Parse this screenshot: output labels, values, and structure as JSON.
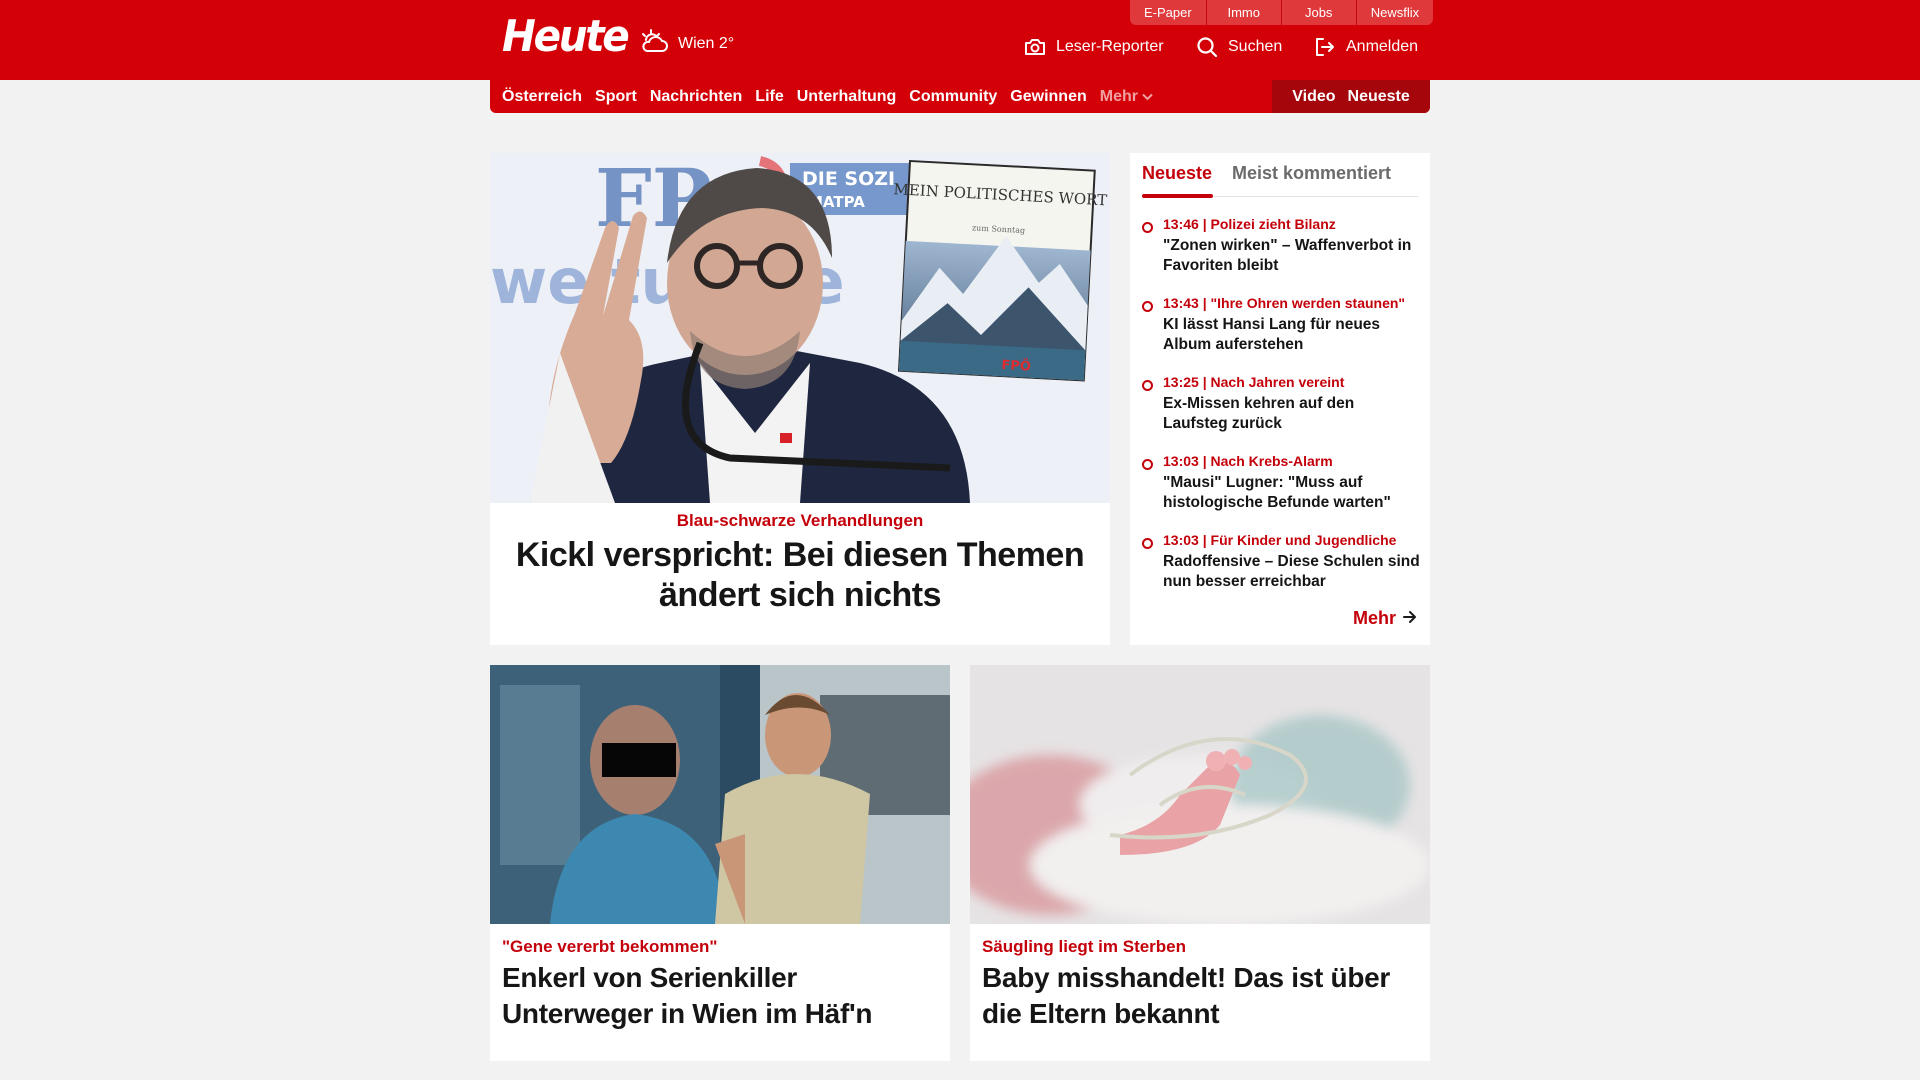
{
  "header": {
    "logo": "Heute",
    "weather": {
      "icon": "cloud-sun-icon",
      "text": "Wien 2°"
    },
    "service_tabs": [
      "E-Paper",
      "Immo",
      "Jobs",
      "Newsflix"
    ],
    "tools": [
      {
        "icon": "camera-icon",
        "label": "Leser-Reporter"
      },
      {
        "icon": "search-icon",
        "label": "Suchen"
      },
      {
        "icon": "login-icon",
        "label": "Anmelden"
      }
    ]
  },
  "nav": {
    "items": [
      "Österreich",
      "Sport",
      "Nachrichten",
      "Life",
      "Unterhaltung",
      "Community",
      "Gewinnen"
    ],
    "more": "Mehr",
    "right": [
      "Video",
      "Neueste"
    ]
  },
  "hero": {
    "kicker": "Blau-schwarze Verhandlungen",
    "title": "Kickl verspricht: Bei diesen Themen ändert sich nichts",
    "image_text": {
      "backdrop_letters": "FP",
      "backdrop_line1": "DIE SOZI",
      "backdrop_line2": "MATPA",
      "backdrop_big": "we  tu     ür  e",
      "book_title": "MEIN POLITISCHES WORT",
      "book_subtitle": "zum Sonntag",
      "book_logo": "FPÖ"
    }
  },
  "sidebar": {
    "tabs": [
      "Neueste",
      "Meist kommentiert"
    ],
    "items": [
      {
        "time": "13:46",
        "kicker": "Polizei zieht Bilanz",
        "headline": "\"Zonen wirken\" – Waffenverbot in Favoriten bleibt"
      },
      {
        "time": "13:43",
        "kicker": "\"Ihre Ohren werden staunen\"",
        "headline": "KI lässt Hansi Lang für neues Album auferstehen"
      },
      {
        "time": "13:25",
        "kicker": "Nach Jahren vereint",
        "headline": "Ex-Missen kehren auf den Laufsteg zurück"
      },
      {
        "time": "13:03",
        "kicker": "Nach Krebs-Alarm",
        "headline": "\"Mausi\" Lugner: \"Muss auf histologische Befunde warten\""
      },
      {
        "time": "13:03",
        "kicker": "Für Kinder und Jugendliche",
        "headline": "Radoffensive – Diese Schulen sind nun besser erreichbar"
      }
    ],
    "more": "Mehr"
  },
  "cards": [
    {
      "kicker": "\"Gene vererbt bekommen\"",
      "title": "Enkerl von Serienkiller Unterweger in Wien im Häf'n"
    },
    {
      "kicker": "Säugling liegt im Sterben",
      "title": "Baby misshandelt! Das ist über die Eltern bekannt"
    }
  ],
  "colors": {
    "brand_red": "#d30008",
    "dark_red": "#a4060b",
    "kicker_red": "#c4000a",
    "background": "#f2f2f2"
  }
}
